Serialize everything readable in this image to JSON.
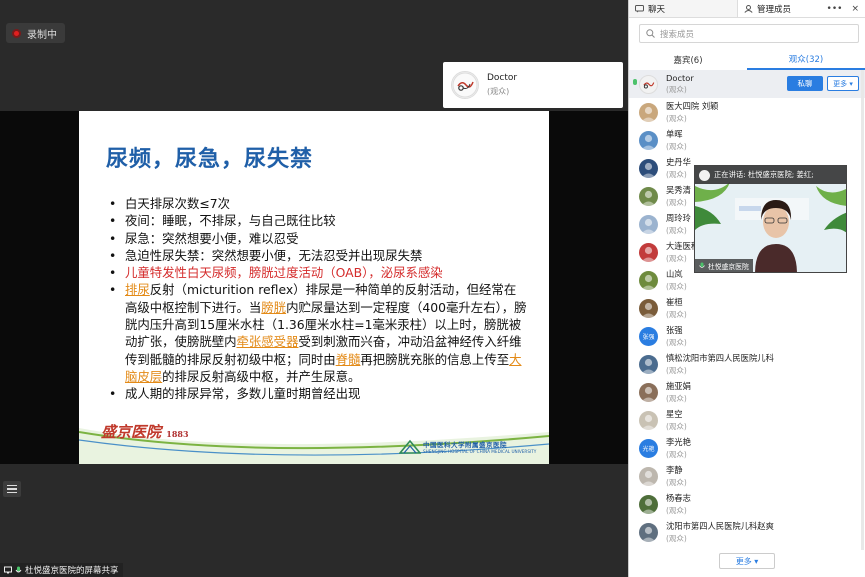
{
  "recording": {
    "label": "录制中"
  },
  "speaker_card": {
    "name": "Doctor",
    "role": "(观众)"
  },
  "slide": {
    "title": "尿频，尿急，尿失禁",
    "bullets": [
      {
        "text": "白天排尿次数≤7次"
      },
      {
        "text": "夜间：睡眠，不排尿，与自己既往比较"
      },
      {
        "text": "尿急：突然想要小便，难以忍受"
      },
      {
        "text": "急迫性尿失禁：突然想要小便，无法忍受并出现尿失禁"
      },
      {
        "text": "儿童特发性白天尿频，膀胱过度活动（OAB），泌尿系感染"
      },
      {
        "seg1": "排尿",
        "seg2": "反射（micturition reflex）排尿是一种简单的反射活动，但经常在高级中枢控制下进行。当",
        "seg3": "膀胱",
        "seg4": "内贮尿量达到一定程度（400毫升左右），膀胱内压升高到15厘米水柱（1.36厘米水柱=1毫米汞柱）以上时，膀胱被动扩张，使膀胱壁内",
        "seg5": "牵张感受器",
        "seg6": "受到刺激而兴奋，冲动沿盆神经传入纤维传到骶髓的排尿反射初级中枢；同时由",
        "seg7": "脊髓",
        "seg8": "再把膀胱充胀的信息上传至",
        "seg9": "大脑皮层",
        "seg10": "的排尿反射高级中枢，并产生尿意。"
      },
      {
        "text": "成人期的排尿异常，多数儿童时期曾经出现"
      }
    ],
    "logo_left": {
      "text": "盛京医院",
      "year": "1883"
    },
    "logo_right": {
      "cn": "中国医科大学附属盛京医院",
      "en": "SHENGJING HOSPITAL OF CHINA MEDICAL UNIVERSITY"
    }
  },
  "share_status": {
    "label": "杜悦盛京医院的屏幕共享"
  },
  "panel": {
    "tab_chat": "聊天",
    "tab_members": "管理成员",
    "tools_more": "•••",
    "tools_close": "×",
    "search_placeholder": "搜索成员",
    "subtab_guests": "嘉宾(6)",
    "subtab_audience": "观众(32)",
    "dm_button": "私聊",
    "more_button": "更多 ▾",
    "footer_more": "更多 ▾"
  },
  "members": [
    {
      "name": "Doctor",
      "role": "(观众)",
      "avatar": "doc",
      "color": "#f2f2f2"
    },
    {
      "name": "医大四院 刘颖",
      "role": "(观众)",
      "avatar": "img",
      "color": "#c9a77c"
    },
    {
      "name": "单晖",
      "role": "(观众)",
      "avatar": "img",
      "color": "#5a8fc6"
    },
    {
      "name": "史丹华",
      "role": "(观众)",
      "avatar": "img",
      "color": "#2d4d7a"
    },
    {
      "name": "吴秀清",
      "role": "(观众)",
      "avatar": "img",
      "color": "#6f8a4a"
    },
    {
      "name": "周玲玲",
      "role": "(观众)",
      "avatar": "img",
      "color": "#9bb3cf"
    },
    {
      "name": "大连医科",
      "role": "(观众)",
      "avatar": "img",
      "color": "#c23b3b"
    },
    {
      "name": "山岚",
      "role": "(观众)",
      "avatar": "img",
      "color": "#6e8b3d"
    },
    {
      "name": "崔桓",
      "role": "(观众)",
      "avatar": "img",
      "color": "#7a5c3a"
    },
    {
      "name": "张强",
      "role": "(观众)",
      "avatar": "text",
      "initials": "张强",
      "color": "#2a7de1"
    },
    {
      "name": "慎松沈阳市第四人民医院儿科",
      "role": "(观众)",
      "avatar": "img",
      "color": "#4b6c8f"
    },
    {
      "name": "施亚娟",
      "role": "(观众)",
      "avatar": "img",
      "color": "#8a6f5a"
    },
    {
      "name": "星空",
      "role": "(观众)",
      "avatar": "img",
      "color": "#c9c2b4"
    },
    {
      "name": "李光艳",
      "role": "(观众)",
      "avatar": "text",
      "initials": "光艳",
      "color": "#2a7de1"
    },
    {
      "name": "李静",
      "role": "(观众)",
      "avatar": "img",
      "color": "#bdb7ae"
    },
    {
      "name": "杨春志",
      "role": "(观众)",
      "avatar": "img",
      "color": "#4e6e3a"
    },
    {
      "name": "沈阳市第四人民医院儿科赵爽",
      "role": "(观众)",
      "avatar": "img",
      "color": "#5f6f7f"
    }
  ],
  "video": {
    "speaking_label": "正在讲话: 杜悦盛京医院; 姜红;",
    "name_label": "杜悦盛京医院"
  },
  "colors": {
    "accent": "#2a7de1",
    "slide_title": "#1f5fa8",
    "highlight": "#e38a17",
    "red_bullet": "#d42b2b",
    "recording": "#e02020"
  }
}
